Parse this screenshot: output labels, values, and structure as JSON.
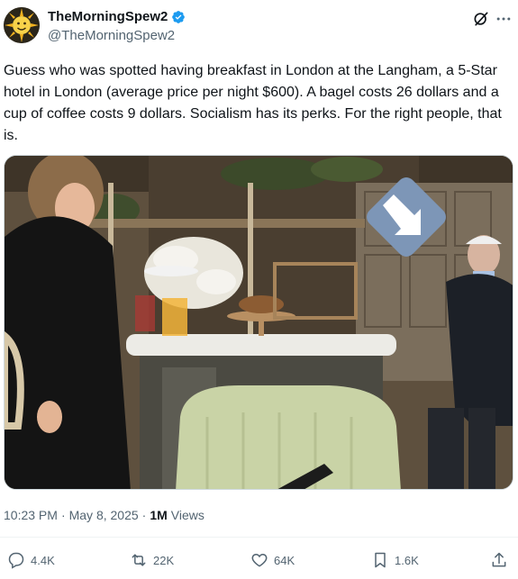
{
  "author": {
    "display_name": "TheMorningSpew2",
    "handle": "@TheMorningSpew2"
  },
  "tweet": {
    "text": "Guess who was spotted having breakfast in London at the Langham, a 5-Star hotel in London (average price per night $600). A bagel costs 26 dollars and a cup of coffee costs 9 dollars. Socialism has its perks. For the right people, that is."
  },
  "meta": {
    "time": "10:23 PM",
    "separator": "·",
    "date": "May 8, 2025",
    "views_count": "1M",
    "views_label": "Views"
  },
  "actions": {
    "replies": "4.4K",
    "reposts": "22K",
    "likes": "64K",
    "bookmarks": "1.6K"
  },
  "icons": {
    "verified": "verified-badge-icon",
    "grok": "grok-icon",
    "more": "more-icon",
    "reply": "reply-icon",
    "repost": "repost-icon",
    "like": "heart-icon",
    "bookmark": "bookmark-icon",
    "share": "share-icon"
  },
  "colors": {
    "verified_blue": "#1d9bf0",
    "secondary_text": "#536471",
    "primary_text": "#0f1419"
  }
}
